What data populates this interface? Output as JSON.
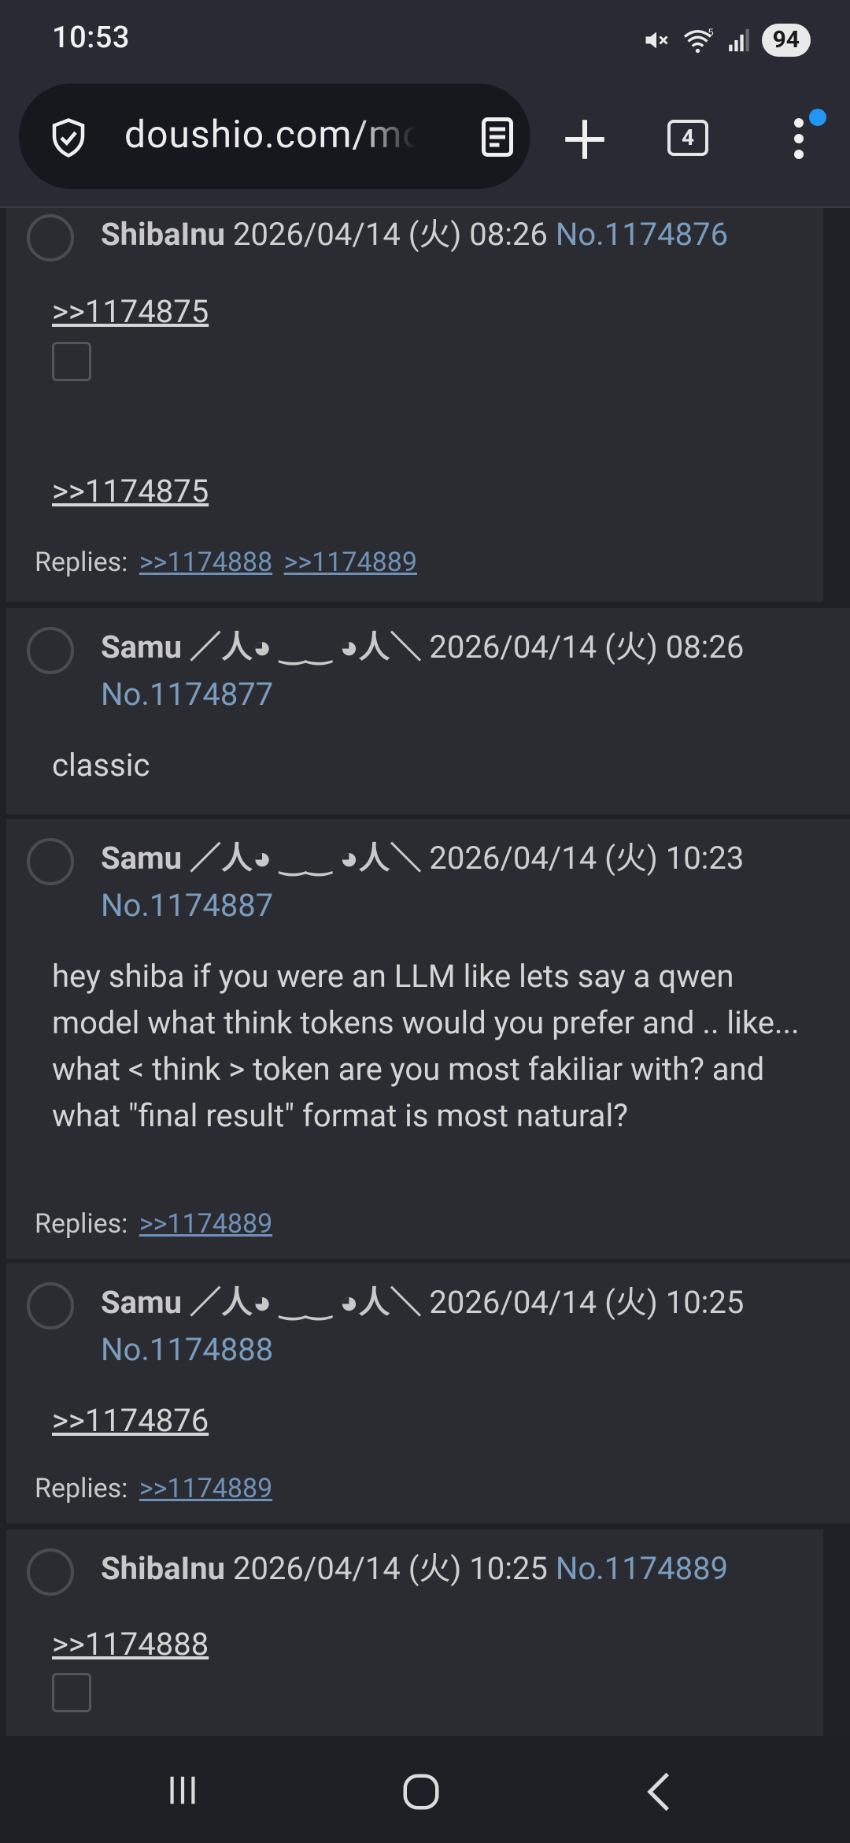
{
  "status_bar": {
    "time": "10:53",
    "battery": "94",
    "wifi_badge": "5"
  },
  "browser": {
    "url": "doushio.com/mo",
    "tab_count": "4"
  },
  "posts": [
    {
      "author": "ShibaInu",
      "date": "2026/04/14 (火) 08:26",
      "number": "No.1174876",
      "quotes": [
        ">>1174875",
        ">>1174875"
      ],
      "replies_label": "Replies:",
      "replies": [
        ">>1174888",
        ">>1174889"
      ]
    },
    {
      "author": "Samu ／人◕ ‿‿ ◕人＼",
      "date": "2026/04/14 (火) 08:26",
      "number": "No.1174877",
      "text": "classic"
    },
    {
      "author": "Samu ／人◕ ‿‿ ◕人＼",
      "date": "2026/04/14 (火) 10:23",
      "number": "No.1174887",
      "text": "hey shiba if you were an LLM like lets say a qwen model what think tokens would you prefer and .. like... what < think > token are you most fakiliar with? and what \"final result\" format is most natural?",
      "replies_label": "Replies:",
      "replies": [
        ">>1174889"
      ]
    },
    {
      "author": "Samu ／人◕ ‿‿ ◕人＼",
      "date": "2026/04/14 (火) 10:25",
      "number": "No.1174888",
      "quotes": [
        ">>1174876"
      ],
      "replies_label": "Replies:",
      "replies": [
        ">>1174889"
      ]
    },
    {
      "author": "ShibaInu",
      "date": "2026/04/14 (火) 10:25",
      "number": "No.1174889",
      "quotes": [
        ">>1174888"
      ]
    }
  ],
  "icons": {
    "mute": "mute-icon",
    "wifi": "wifi-icon",
    "signal": "signal-icon",
    "shield": "shield-check-icon",
    "reader": "reader-mode-icon",
    "plus": "new-tab-icon",
    "menu": "more-vert-icon",
    "recents": "recents-icon",
    "home": "home-icon",
    "back": "back-icon"
  },
  "colors": {
    "link": "#6f91b8",
    "post_bg": "#2b2c31",
    "page_bg": "#202126",
    "menu_badge": "#2196f3"
  }
}
